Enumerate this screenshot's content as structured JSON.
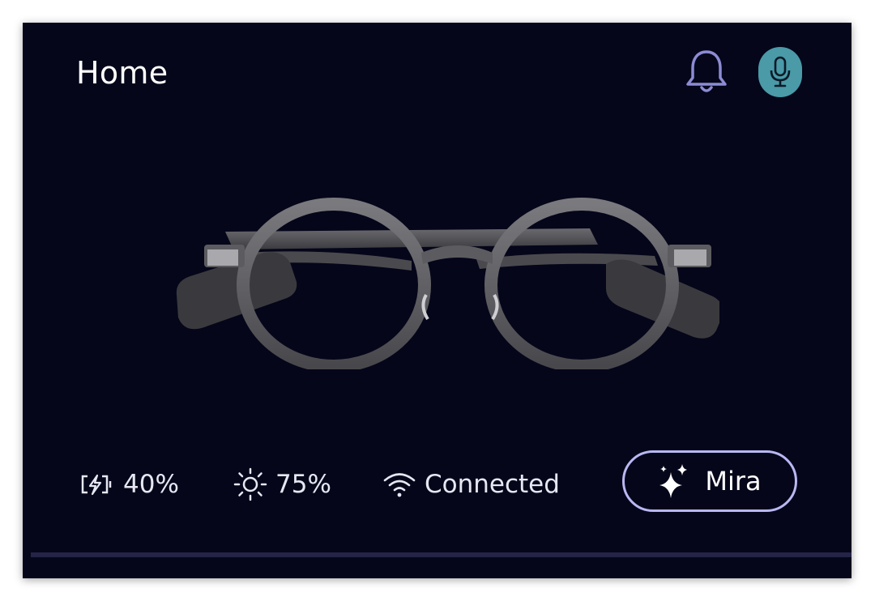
{
  "header": {
    "title": "Home",
    "icons": [
      "bell-icon",
      "microphone-icon"
    ]
  },
  "status": {
    "battery": "40%",
    "brightness": "75%",
    "connection": "Connected"
  },
  "mira_button": {
    "label": "Mira",
    "icon": "sparkles-icon"
  },
  "colors": {
    "background": "#05061a",
    "mic_button": "#4a9aa8",
    "mira_border": "#b9b7f2",
    "bell": "#8c8bd3"
  }
}
